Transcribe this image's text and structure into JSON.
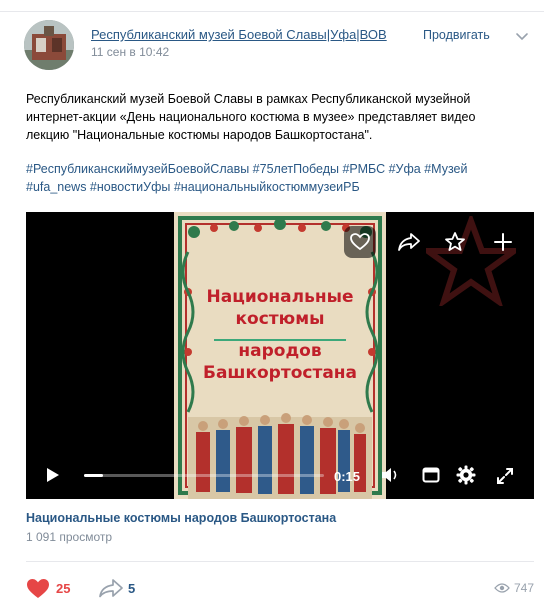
{
  "post": {
    "author": "Республиканский музей Боевой Славы|Уфа|ВОВ",
    "date": "11 сен в 10:42",
    "promote_label": "Продвигать",
    "text_lines": [
      "Республиканский музей Боевой Славы в рамках Республиканской музейной",
      "интернет-акции «День национального костюма в музее» представляет видео",
      "лекцию \"Национальные костюмы народов Башкортостана\"."
    ],
    "hashtag_lines": [
      "#РеспубликанскиймузейБоевойСлавы #75летПобеды #РМБС #Уфа #Музей",
      "#ufa_news #новостиУфы #национальныйкостюммузеиРБ"
    ]
  },
  "video": {
    "poster_lines": [
      "Национальные",
      "костюмы",
      "народов",
      "Башкортостана"
    ],
    "current_time": "0:15",
    "progress": 0.08,
    "title": "Национальные костюмы народов Башкортостана",
    "views": "1 091 просмотр"
  },
  "footer": {
    "likes": "25",
    "shares": "5",
    "views": "747"
  },
  "colors": {
    "link": "#2a5885",
    "like": "#e64646",
    "poster_text": "#c0202a"
  }
}
